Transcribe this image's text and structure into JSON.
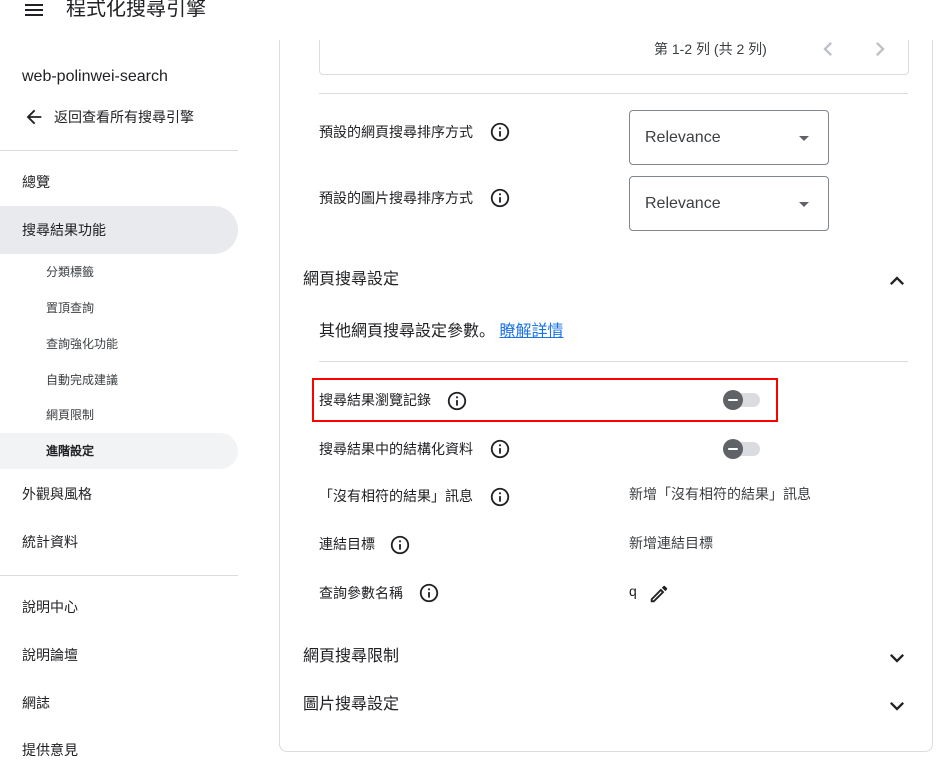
{
  "header": {
    "title": "程式化搜尋引擎",
    "menu_icon": "menu-icon"
  },
  "sidebar": {
    "engine_name": "web-polinwei-search",
    "back_label": "返回查看所有搜尋引擎",
    "back_icon": "arrow-back-icon",
    "overview": "總覽",
    "search_features": {
      "label": "搜尋結果功能",
      "subitems": [
        "分類標籤",
        "置頂查詢",
        "查詢強化功能",
        "自動完成建議",
        "網頁限制",
        "進階設定"
      ],
      "active_subitem": "進階設定"
    },
    "look_and_feel": "外觀與風格",
    "statistics": "統計資料",
    "help_links": [
      "說明中心",
      "說明論壇",
      "網誌",
      "提供意見"
    ]
  },
  "main": {
    "pagination": {
      "summary": "第 1-2 列 (共 2 列)"
    },
    "sort_settings": [
      {
        "label": "預設的網頁搜尋排序方式",
        "value": "Relevance"
      },
      {
        "label": "預設的圖片搜尋排序方式",
        "value": "Relevance"
      }
    ],
    "web_search_settings": {
      "title": "網頁搜尋設定",
      "expanded": true,
      "description": "其他網頁搜尋設定參數。",
      "learn_more": "瞭解詳情",
      "settings": [
        {
          "label": "搜尋結果瀏覽記錄",
          "enabled": false
        },
        {
          "label": "搜尋結果中的結構化資料",
          "enabled": false
        },
        {
          "label": "「沒有相符的結果」訊息",
          "value": "新增「沒有相符的結果」訊息"
        },
        {
          "label": "連結目標",
          "value": "新增連結目標"
        },
        {
          "label": "查詢參數名稱",
          "value": "q"
        }
      ]
    },
    "web_search_restrictions": {
      "title": "網頁搜尋限制",
      "expanded": false
    },
    "image_search_settings": {
      "title": "圖片搜尋設定",
      "expanded": false
    }
  },
  "colors": {
    "link": "#1a73e8",
    "highlight": "#ff0000",
    "active_bg": "#e8eaed",
    "sub_active_bg": "#f1f3f4",
    "toggle_knob": "#5f6368"
  }
}
